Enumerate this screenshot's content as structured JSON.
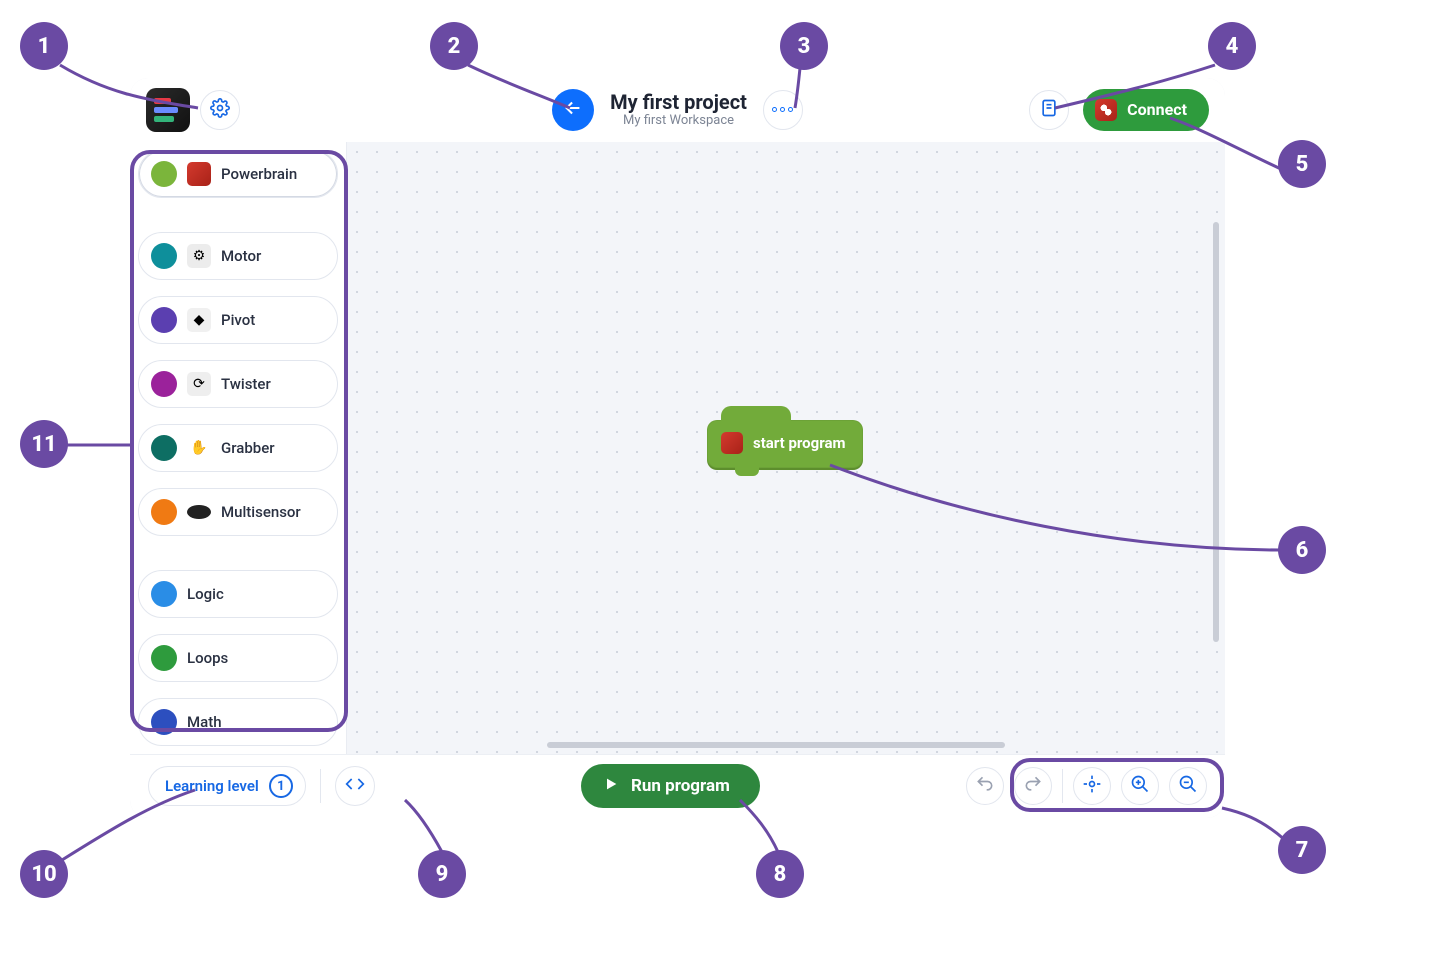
{
  "header": {
    "project_title": "My first project",
    "workspace_subtitle": "My first Workspace",
    "connect_label": "Connect"
  },
  "palette": {
    "items": [
      {
        "label": "Powerbrain",
        "color": "#7bb53b",
        "icon": "cube"
      },
      {
        "label": "Motor",
        "color": "#0e8f9b",
        "icon": "gear"
      },
      {
        "label": "Pivot",
        "color": "#5b3fb0",
        "icon": "pivot"
      },
      {
        "label": "Twister",
        "color": "#9b229b",
        "icon": "twist"
      },
      {
        "label": "Grabber",
        "color": "#0d6e63",
        "icon": "grab"
      },
      {
        "label": "Multisensor",
        "color": "#f07a13",
        "icon": "multi"
      },
      {
        "label": "Logic",
        "color": "#2a8de6",
        "icon": ""
      },
      {
        "label": "Loops",
        "color": "#2e9b3d",
        "icon": ""
      },
      {
        "label": "Math",
        "color": "#2c4fbf",
        "icon": ""
      }
    ]
  },
  "canvas": {
    "start_block_label": "start program"
  },
  "footer": {
    "learning_label": "Learning level",
    "learning_level": "1",
    "run_label": "Run program"
  },
  "callouts": {
    "n1": "1",
    "n2": "2",
    "n3": "3",
    "n4": "4",
    "n5": "5",
    "n6": "6",
    "n7": "7",
    "n8": "8",
    "n9": "9",
    "n10": "10",
    "n11": "11"
  }
}
